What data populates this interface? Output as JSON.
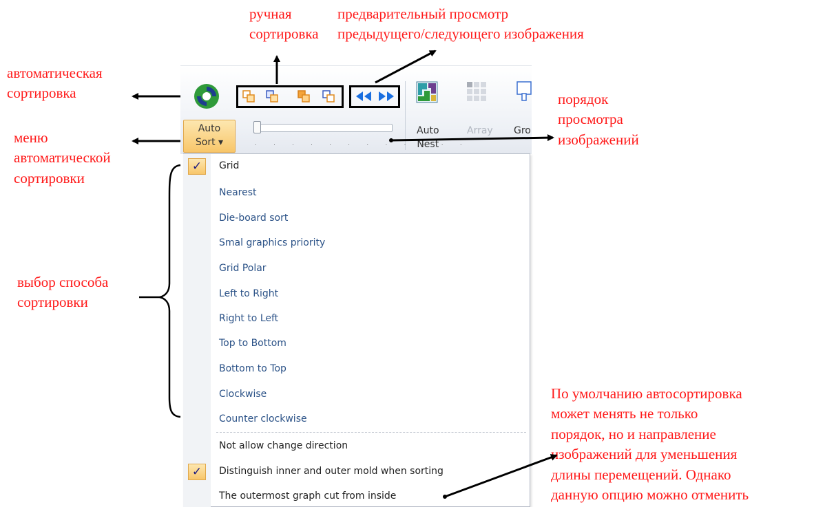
{
  "annotations": {
    "manual_sort": [
      "ручная",
      "сортировка"
    ],
    "preview": [
      "предварительный просмотр",
      "предыдущего/следующего изображения"
    ],
    "auto_sort": [
      "автоматическая",
      "сортировка"
    ],
    "auto_sort_menu": [
      "меню",
      "автоматической",
      "сортировки"
    ],
    "view_order": [
      "порядок",
      "просмотра",
      "изображений"
    ],
    "sort_choice": [
      "выбор способа",
      "сортировки"
    ],
    "default_note": [
      "По умолчанию автосортировка",
      "может менять не только",
      "порядок, но и направление",
      "изображений для уменьшения",
      "длины перемещений. Однако",
      "данную опцию можно отменить"
    ]
  },
  "ribbon": {
    "auto_sort_label": [
      "Auto",
      "Sort ▾"
    ],
    "auto_nest_label": [
      "Auto",
      "Nest"
    ],
    "array_label": "Array",
    "group_label": "Gro",
    "tick_marks": ". . . . . . . . . . . ."
  },
  "menu": {
    "items": [
      {
        "label": "Grid",
        "checked": true
      },
      {
        "label": "Nearest",
        "checked": false
      },
      {
        "label": "Die-board sort",
        "checked": false
      },
      {
        "label": "Smal graphics priority",
        "checked": false
      },
      {
        "label": "Grid Polar",
        "checked": false
      },
      {
        "label": "Left to Right",
        "checked": false
      },
      {
        "label": "Right to Left",
        "checked": false
      },
      {
        "label": "Top to Bottom",
        "checked": false
      },
      {
        "label": "Bottom to Top",
        "checked": false
      },
      {
        "label": "Clockwise",
        "checked": false
      },
      {
        "label": "Counter clockwise",
        "checked": false
      }
    ],
    "options": [
      {
        "label": "Not allow change direction",
        "checked": false
      },
      {
        "label": "Distinguish inner and outer mold when sorting",
        "checked": true
      },
      {
        "label": "The outermost graph cut from inside",
        "checked": false
      }
    ],
    "check_glyph": "✓"
  },
  "colors": {
    "annotation": "#ff1a1a",
    "menu_text": "#2b5287",
    "highlight": "#f8c66a",
    "preview_arrows": "#1a6fe0"
  }
}
